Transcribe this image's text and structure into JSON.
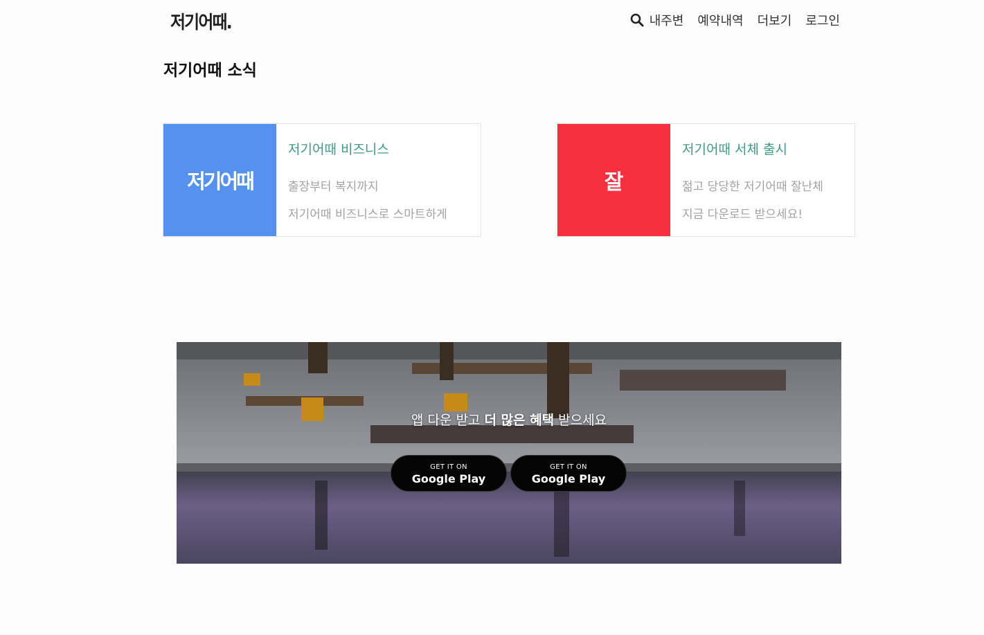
{
  "header": {
    "logo": "저기어때.",
    "nav": [
      "내주변",
      "예약내역",
      "더보기",
      "로그인"
    ]
  },
  "news": {
    "title": "저기어때 소식",
    "cards": [
      {
        "thumb_text": "저기어때",
        "thumb_color": "#5591ee",
        "title": "저기어때 비즈니스",
        "lines": [
          "출장부터 복지까지",
          "저기어때 비즈니스로 스마트하게"
        ]
      },
      {
        "thumb_text": "잘",
        "thumb_color": "#f6303f",
        "title": "저기어때 서체 출시",
        "lines": [
          "젊고 당당한 저기어때 잘난체",
          "지금 다운로드 받으세요!"
        ]
      }
    ]
  },
  "banner": {
    "text_prefix": "앱 다운 받고 ",
    "text_bold": "더 많은 혜택",
    "text_suffix": " 받으세요",
    "buttons": [
      {
        "small": "GET IT ON",
        "big": "Google Play"
      },
      {
        "small": "GET IT ON",
        "big": "Google Play"
      }
    ]
  },
  "colors": {
    "accent_green": "#3e9a84",
    "muted_text": "#a2a2a2"
  }
}
